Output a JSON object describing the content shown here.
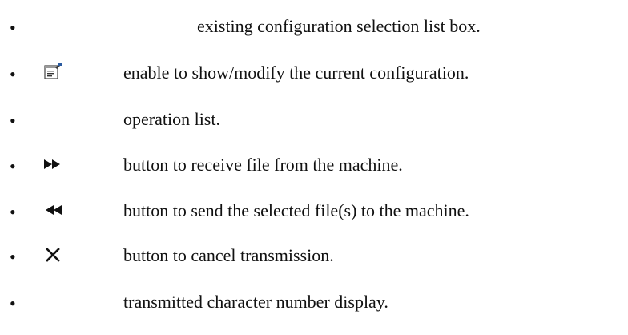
{
  "items": [
    {
      "icon": "",
      "text": "existing configuration selection list box."
    },
    {
      "icon": "properties-icon",
      "text": "enable to show/modify the current configuration."
    },
    {
      "icon": "",
      "text": "operation list."
    },
    {
      "icon": "fast-forward-icon",
      "text": "button to receive file from the machine."
    },
    {
      "icon": "rewind-icon",
      "text": "button to send the selected file(s) to the machine."
    },
    {
      "icon": "close-icon",
      "text": "button to cancel transmission."
    },
    {
      "icon": "",
      "text": "transmitted character number display."
    }
  ],
  "bullet": "•"
}
